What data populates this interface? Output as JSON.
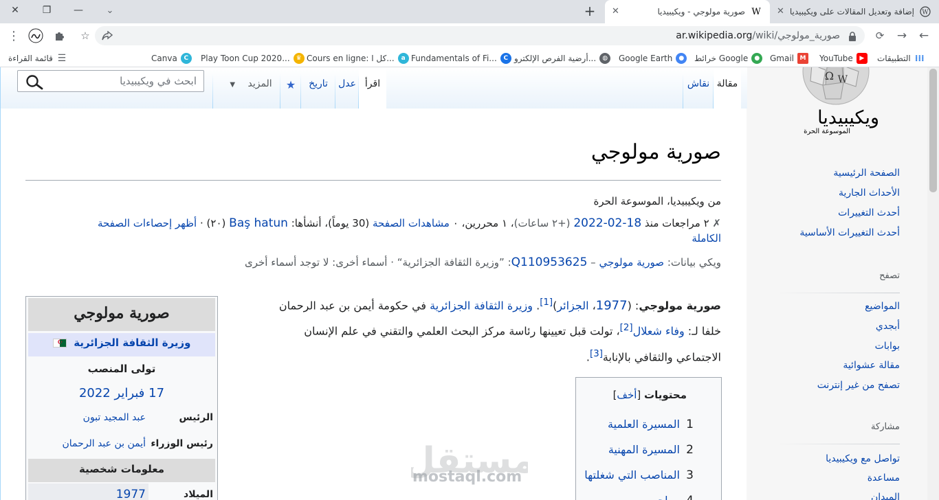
{
  "browser": {
    "tabs": [
      {
        "title": "صورية مولوجي - ويكيبيديا",
        "favicon": "W",
        "active": true
      },
      {
        "title": "إضافة وتعديل المقالات على ويكيبيديا",
        "active": false
      }
    ],
    "url_domain": "ar.wikipedia.org",
    "url_path": "/wiki/صورية_مولوجي",
    "bookmarks": [
      "التطبيقات",
      "YouTube",
      "Gmail",
      "خرائط Google",
      "Google Earth",
      "أرضية الفرص الإلكترو...",
      "Fundamentals of Fi...",
      "Cours en ligne: كل ا...",
      "Play Toon Cup 2020...",
      "Canva",
      "قائمة القراءة"
    ]
  },
  "sidebar": {
    "logo_title": "ويكيبيديا",
    "logo_tagline": "الموسوعة الحرة",
    "main_links": [
      "الصفحة الرئيسية",
      "الأحداث الجارية",
      "أحدث التغييرات",
      "أحدث التغييرات الأساسية"
    ],
    "browse_heading": "تصفح",
    "browse_links": [
      "المواضيع",
      "أبجدي",
      "بوابات",
      "مقالة عشوائية",
      "تصفح من غير إنترنت"
    ],
    "participate_heading": "مشاركة",
    "participate_links": [
      "تواصل مع ويكيبيديا",
      "مساعدة",
      "الميدان"
    ]
  },
  "tabs": {
    "article": "مقالة",
    "talk": "نقاش",
    "read": "اقرأ",
    "edit": "عدل",
    "history": "تاريخ",
    "more": "المزيد",
    "search_placeholder": "ابحث في ويكيبيديا"
  },
  "article": {
    "title": "صورية مولوجي",
    "from": "من ويكيبيديا، الموسوعة الحرة",
    "stats_1": "٢ مراجعات منذ",
    "stats_date": "18-02-2022",
    "stats_hours": "(+٢ ساعات)",
    "stats_2": "، ١ محررين، ٠",
    "stats_views": "مشاهدات الصفحة",
    "stats_3": "(30 يوماً)، أنشأها:",
    "stats_creator": "Baş hatun",
    "stats_4": "(٢٠) ·",
    "stats_show": "أظهر إحصاءات الصفحة",
    "stats_full": "الكاملة",
    "wikidata_label": "ويكي بيانات:",
    "wikidata_name": "صورية مولوجي",
    "wikidata_sep": "–",
    "wikidata_id": "Q110953625",
    "wikidata_rest": ": ”وزيرة الثقافة الجزائرية“ · أسماء أخرى: لا توجد أسماء أخرى",
    "p1_bold": "صورية مولوجي",
    "p1_a": ": (",
    "p1_year": "1977",
    "p1_sep": "، ",
    "p1_place": "الجزائر",
    "p1_b": ")",
    "ref1": "[1]",
    "p1_c": ". ",
    "p1_role": "وزيرة الثقافة الجزائرية",
    "p1_d": " في حكومة أيمن بن عبد الرحمان",
    "p2_a": "خلفا لـ: ",
    "p2_pred": "وفاء شعلال",
    "ref2": "[2]",
    "p2_b": "، تولت قبل تعيينها رئاسة مركز البحث العلمي والتقني في علم الإنسان",
    "p3_a": "الاجتماعي والثقافي بالإنابة",
    "ref3": "[3]",
    "p3_b": "."
  },
  "infobox": {
    "name": "صورية مولوجي",
    "office": "وزيرة الثقافة الجزائرية",
    "term_label": "تولى المنصب",
    "term_date": "17 فبراير 2022",
    "president_label": "الرئيس",
    "president": "عبد المجيد تبون",
    "pm_label": "رئيس الوزراء",
    "pm": "أيمن بن عبد الرحمان",
    "personal_header": "معلومات شخصية",
    "birth_label": "الميلاد",
    "birth_year": "1977"
  },
  "toc": {
    "title": "محتويات",
    "hide": "أخف",
    "items": [
      {
        "num": "1",
        "label": "المسيرة العلمية"
      },
      {
        "num": "2",
        "label": "المسيرة المهنية"
      },
      {
        "num": "3",
        "label": "المناصب التي شغلتها"
      },
      {
        "num": "4",
        "label": "مراجع"
      }
    ]
  },
  "watermark": {
    "arabic": "مستقل",
    "latin": "mostaql.com"
  }
}
